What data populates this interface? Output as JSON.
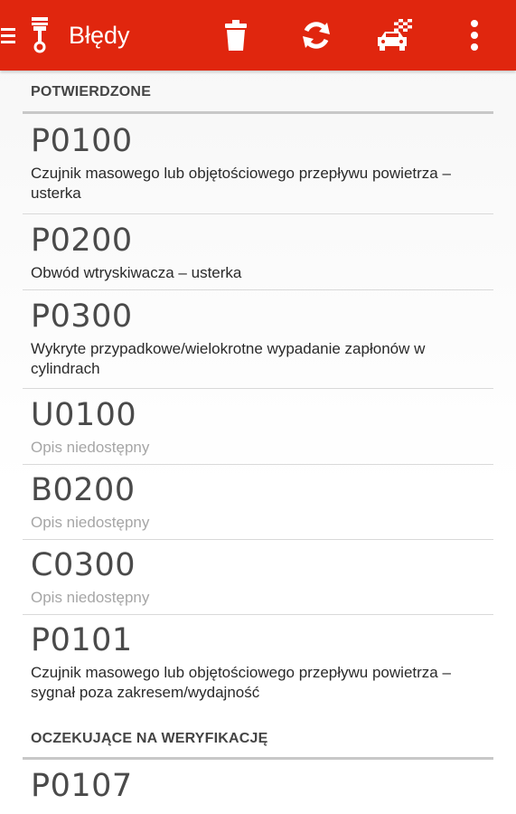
{
  "toolbar": {
    "title": "Błędy",
    "color": "#e0260e",
    "icons": {
      "menu": "hamburger-icon",
      "logo": "piston-icon",
      "delete": "trash-icon",
      "refresh": "refresh-icon",
      "car": "car-checkered-flag-icon",
      "more": "more-vertical-icon"
    }
  },
  "sections": [
    {
      "title": "POTWIERDZONE",
      "items": [
        {
          "code": "P0100",
          "description": "Czujnik masowego lub objętościowego przepływu powietrza – usterka"
        },
        {
          "code": "P0200",
          "description": "Obwód wtryskiwacza – usterka"
        },
        {
          "code": "P0300",
          "description": "Wykryte przypadkowe/wielokrotne wypadanie zapłonów w cylindrach"
        },
        {
          "code": "U0100",
          "description": "Opis niedostępny"
        },
        {
          "code": "B0200",
          "description": "Opis niedostępny"
        },
        {
          "code": "C0300",
          "description": "Opis niedostępny"
        },
        {
          "code": "P0101",
          "description": "Czujnik masowego lub objętościowego przepływu powietrza – sygnał poza zakresem/wydajność"
        }
      ]
    },
    {
      "title": "OCZEKUJĄCE NA WERYFIKACJĘ",
      "items": [
        {
          "code": "P0107",
          "description": ""
        }
      ]
    }
  ]
}
